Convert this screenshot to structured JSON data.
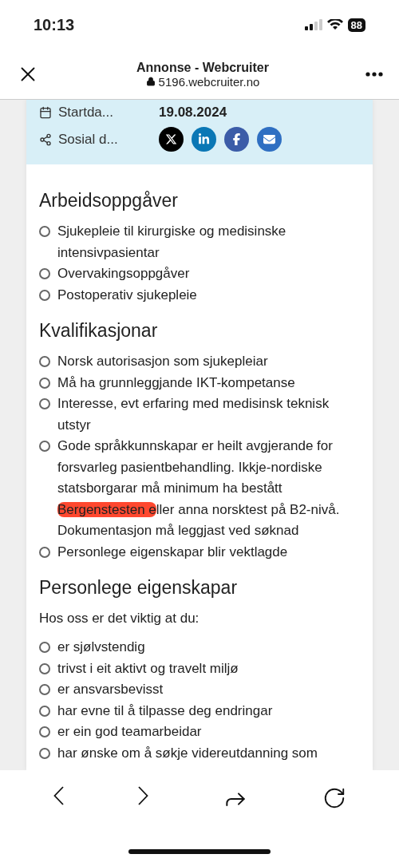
{
  "status_bar": {
    "time": "10:13",
    "battery": "88"
  },
  "browser": {
    "title": "Annonse - Webcruiter",
    "url": "5196.webcruiter.no"
  },
  "info_box": {
    "rows": [
      {
        "kind": "date",
        "label": "Startda...",
        "value": "19.08.2024"
      },
      {
        "kind": "social",
        "label": "Sosial d...",
        "links": [
          {
            "kind": "x"
          },
          {
            "kind": "linkedin"
          },
          {
            "kind": "facebook"
          },
          {
            "kind": "email"
          }
        ]
      }
    ]
  },
  "sections": [
    {
      "heading": "Arbeidsoppgåver",
      "items": [
        {
          "parts": [
            {
              "text": "Sjukepleie til kirurgiske og medisinske intensivpasientar",
              "marked": false
            }
          ]
        },
        {
          "parts": [
            {
              "text": "Overvakingsoppgåver",
              "marked": false
            }
          ]
        },
        {
          "parts": [
            {
              "text": "Postoperativ sjukepleie",
              "marked": false
            }
          ]
        }
      ]
    },
    {
      "heading": "Kvalifikasjonar",
      "items": [
        {
          "parts": [
            {
              "text": "Norsk autorisasjon som sjukepleiar",
              "marked": false
            }
          ]
        },
        {
          "parts": [
            {
              "text": "Må ha grunnleggjande IKT-kompetanse",
              "marked": false
            }
          ]
        },
        {
          "parts": [
            {
              "text": "Interesse, evt erfaring med medisinsk teknisk utstyr",
              "marked": false
            }
          ]
        },
        {
          "parts": [
            {
              "text": "Gode språkkunnskapar er heilt avgjerande for forsvarleg pasientbehandling. Ikkje-nordiske statsborgarar må minimum ha bestått ",
              "marked": false
            },
            {
              "text": "Bergenstesten e",
              "marked": true
            },
            {
              "text": "ller anna norsktest på B2-nivå. Dokumentasjon må leggjast ved søknad",
              "marked": false
            }
          ]
        },
        {
          "parts": [
            {
              "text": "Personlege eigenskapar blir vektlagde",
              "marked": false
            }
          ]
        }
      ]
    },
    {
      "heading": "Personlege eigenskapar",
      "intro": "Hos oss er det viktig at du:",
      "items": [
        {
          "parts": [
            {
              "text": "er sjølvstendig",
              "marked": false
            }
          ]
        },
        {
          "parts": [
            {
              "text": "trivst i eit aktivt og travelt miljø",
              "marked": false
            }
          ]
        },
        {
          "parts": [
            {
              "text": "er ansvarsbevisst",
              "marked": false
            }
          ]
        },
        {
          "parts": [
            {
              "text": "har evne til å tilpasse deg endringar",
              "marked": false
            }
          ]
        },
        {
          "parts": [
            {
              "text": "er ein god teamarbeidar",
              "marked": false
            }
          ]
        },
        {
          "parts": [
            {
              "text": "har ønske om å søkje videreutdanning som",
              "marked": false
            }
          ]
        }
      ]
    }
  ]
}
